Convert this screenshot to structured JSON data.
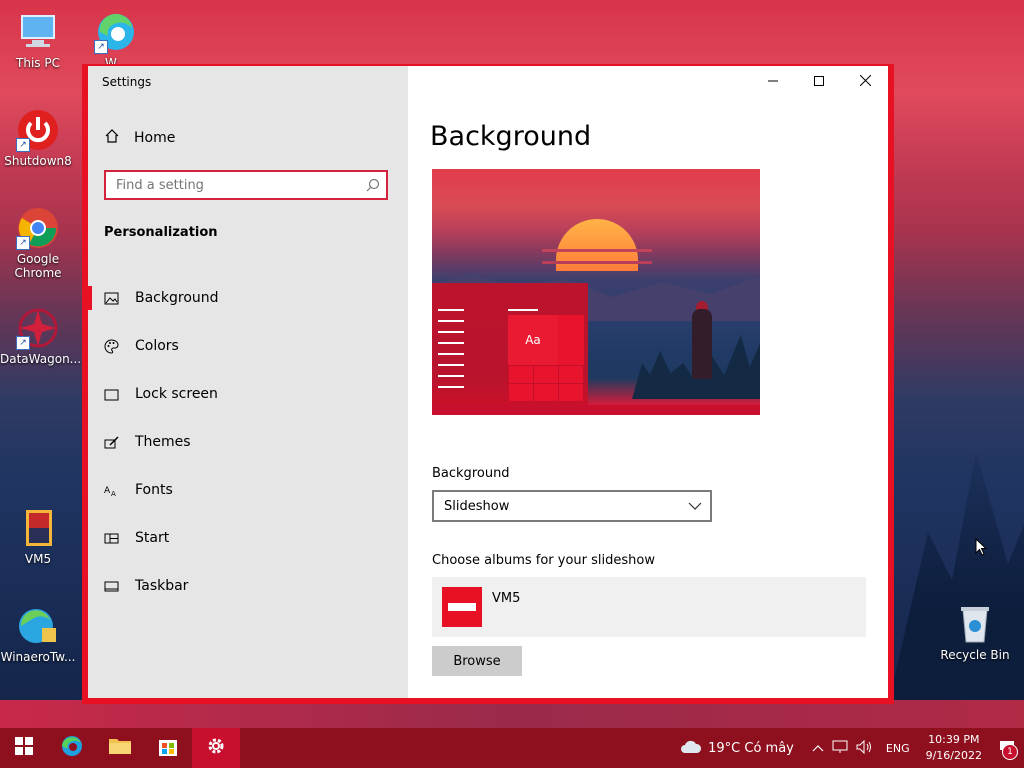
{
  "desktop": {
    "icons": [
      {
        "label": "This PC"
      },
      {
        "label": "Shutdown8"
      },
      {
        "label": "Google Chrome"
      },
      {
        "label": "DataWagon..."
      },
      {
        "label": "VM5"
      },
      {
        "label": "WinaeroTw..."
      },
      {
        "label": "Recycle Bin"
      },
      {
        "label": "W..."
      }
    ]
  },
  "settings": {
    "window_title": "Settings",
    "home_label": "Home",
    "search_placeholder": "Find a setting",
    "section_title": "Personalization",
    "nav": [
      {
        "label": "Background",
        "icon": "picture-icon"
      },
      {
        "label": "Colors",
        "icon": "palette-icon"
      },
      {
        "label": "Lock screen",
        "icon": "lock-screen-icon"
      },
      {
        "label": "Themes",
        "icon": "brush-icon"
      },
      {
        "label": "Fonts",
        "icon": "font-icon"
      },
      {
        "label": "Start",
        "icon": "start-icon"
      },
      {
        "label": "Taskbar",
        "icon": "taskbar-icon"
      }
    ],
    "page_title": "Background",
    "preview_tile_text": "Aa",
    "background_label": "Background",
    "background_value": "Slideshow",
    "albums_label": "Choose albums for your slideshow",
    "album_name": "VM5",
    "browse_label": "Browse",
    "accent_color": "#e81123"
  },
  "taskbar": {
    "weather": "19°C  Có mây",
    "language": "ENG",
    "time": "10:39 PM",
    "date": "9/16/2022",
    "notification_count": "1",
    "color": "#8e0f1e"
  }
}
